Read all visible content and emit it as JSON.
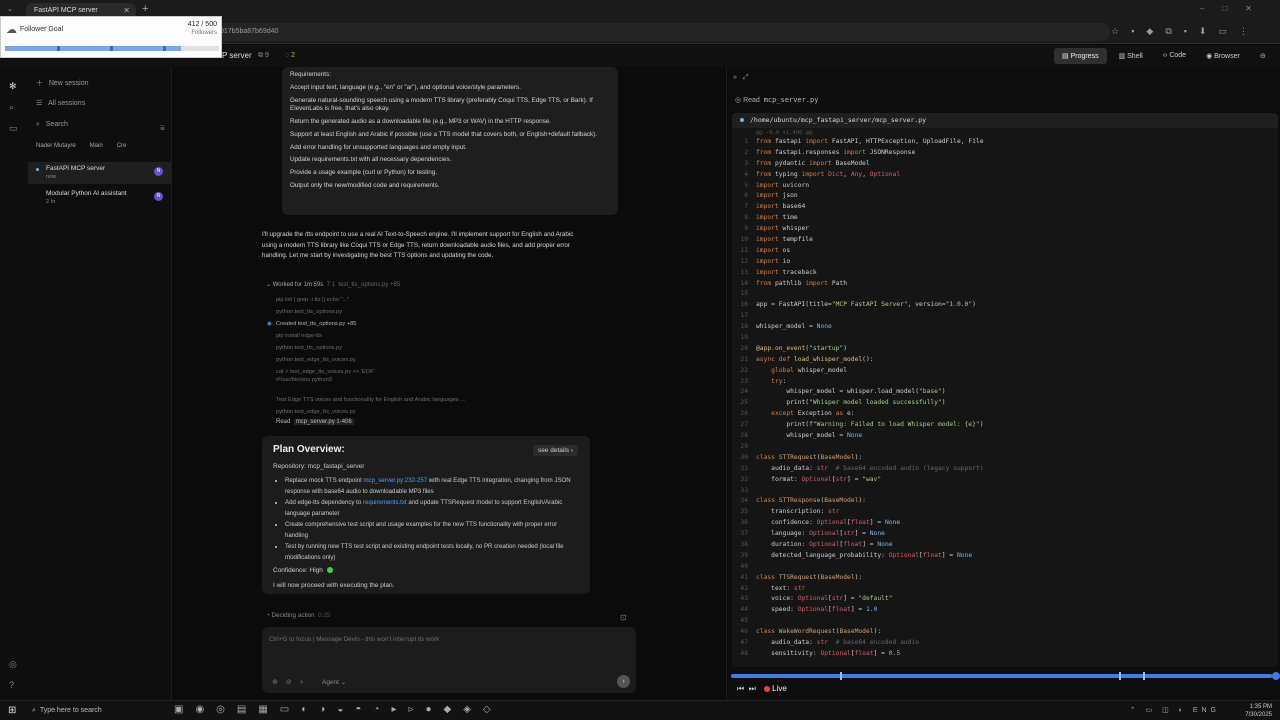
{
  "browser": {
    "tab_title": "FastAPI MCP server",
    "url_fragment": "917b5ba87b69d40"
  },
  "follower_goal": {
    "title": "Follower Goal",
    "count": "412 / 500",
    "label": "Followers",
    "progress": 0.824
  },
  "header": {
    "repo": "P server",
    "meta_count": "9",
    "meta_badge": "2",
    "tabs": [
      "Progress",
      "Shell",
      "Code",
      "Browser"
    ]
  },
  "sidebar": {
    "new_session": "New session",
    "all_sessions": "All sessions",
    "search": "Search",
    "user_tabs": [
      "Nader Mutayre",
      "Main",
      "Cre"
    ],
    "sessions": [
      {
        "title": "FastAPI MCP server",
        "sub": "now",
        "avatar": "N"
      },
      {
        "title": "Modular Python AI assistant",
        "sub": "2 hr",
        "avatar": "N"
      }
    ]
  },
  "chat": {
    "requirements_title": "Requirements:",
    "requirements": [
      "Accept input text, language (e.g., \"en\" or \"ar\"), and optional voice/style parameters.",
      "Generate natural-sounding speech using a modern TTS library (preferably Coqui TTS, Edge TTS, or Bark). If ElevenLabs is free, that's also okay.",
      "Return the generated audio as a downloadable file (e.g., MP3 or WAV) in the HTTP response.",
      "Support at least English and Arabic if possible (use a TTS model that covers both, or English+default fallback).",
      "Add error handling for unsupported languages and empty input.",
      "Update requirements.txt with all necessary dependencies.",
      "Provide a usage example (curl or Python) for testing.",
      "Output only the new/modified code and requirements."
    ],
    "reply": "I'll upgrade the /tts endpoint to use a real AI Text-to-Speech engine. I'll implement support for English and Arabic using a modern TTS library like Coqui TTS or Edge TTS, return downloadable audio files, and add proper error handling. Let me start by investigating the best TTS options and updating the code.",
    "worked": "Worked for 1m 59s",
    "worked_meta": "7   1",
    "worked_file": "test_tts_options.py +85",
    "steps": [
      "pip list | grep -i tts || echo \"...\"",
      "python test_tts_options.py",
      "Created test_tts_options.py +85",
      "pip install edge-tts",
      "python test_tts_options.py",
      "python test_edge_tts_voices.py",
      "cat > test_edge_tts_voices.py << 'EOF'",
      "#!/usr/bin/env python3",
      "Test Edge TTS voices and functionality for English and Arabic languages ...",
      "python test_edge_tts_voices.py"
    ],
    "read_label": "Read",
    "read_file": "mcp_server.py 1-406",
    "plan": {
      "title": "Plan Overview:",
      "see_details": "see details",
      "repository": "Repository: mcp_fastapi_server",
      "items": [
        {
          "pre": "Replace mock TTS endpoint ",
          "code": "mcp_server.py:232-257",
          "post": " with real Edge TTS integration, changing from JSON response with base64 audio to downloadable MP3 files"
        },
        {
          "pre": "Add edge-tts dependency to ",
          "code": "requirements.txt",
          "post": " and update TTSRequest model to support English/Arabic language parameter"
        },
        {
          "pre": "Create comprehensive test script and usage examples for the new TTS functionality with proper error handling",
          "code": "",
          "post": ""
        },
        {
          "pre": "Test by running new TTS test script and existing endpoint tests locally, no PR creation needed (local file modifications only)",
          "code": "",
          "post": ""
        }
      ],
      "confidence": "Confidence: High",
      "proceed": "I will now proceed with executing the plan."
    },
    "deciding": "Deciding action",
    "deciding_time": "0:25",
    "input_placeholder": "Ctrl+G to focus | Message Devin - this won't interrupt its work",
    "agent_label": "Agent"
  },
  "right_panel": {
    "read_label": "Read",
    "read_file": "mcp_server.py",
    "path": "/home/ubuntu/mcp_fastapi_server/mcp_server.py",
    "hunk": "@@ -0,0 +1,406 @@",
    "live_label": "Live",
    "timeline_progress": 0.99,
    "timeline_ticks": [
      0.2,
      0.71,
      0.755
    ]
  },
  "code_lines": [
    {
      "n": "1",
      "h": "<span class='kw'>from</span> fastapi <span class='kw'>import</span> FastAPI, HTTPException, UploadFile, File"
    },
    {
      "n": "2",
      "h": "<span class='kw'>from</span> fastapi.responses <span class='kw'>import</span> JSONResponse"
    },
    {
      "n": "3",
      "h": "<span class='kw'>from</span> pydantic <span class='kw'>import</span> BaseModel"
    },
    {
      "n": "4",
      "h": "<span class='kw'>from</span> typing <span class='kw'>import</span> <span class='ty'>Dict</span>, <span class='ty'>Any</span>, <span class='ty'>Optional</span>"
    },
    {
      "n": "5",
      "h": "<span class='kw'>import</span> uvicorn"
    },
    {
      "n": "6",
      "h": "<span class='kw'>import</span> json"
    },
    {
      "n": "7",
      "h": "<span class='kw'>import</span> base64"
    },
    {
      "n": "8",
      "h": "<span class='kw'>import</span> time"
    },
    {
      "n": "9",
      "h": "<span class='kw'>import</span> whisper"
    },
    {
      "n": "10",
      "h": "<span class='kw'>import</span> tempfile"
    },
    {
      "n": "11",
      "h": "<span class='kw'>import</span> os"
    },
    {
      "n": "12",
      "h": "<span class='kw'>import</span> io"
    },
    {
      "n": "13",
      "h": "<span class='kw'>import</span> traceback"
    },
    {
      "n": "14",
      "h": "<span class='kw'>from</span> pathlib <span class='kw'>import</span> Path"
    },
    {
      "n": "15",
      "h": ""
    },
    {
      "n": "16",
      "h": "app = FastAPI(title=<span class='st'>\"MCP FastAPI Server\"</span>, version=<span class='st'>\"1.0.0\"</span>)"
    },
    {
      "n": "17",
      "h": ""
    },
    {
      "n": "18",
      "h": "whisper_model = <span class='num'>None</span>"
    },
    {
      "n": "19",
      "h": ""
    },
    {
      "n": "20",
      "h": "<span class='fn-c'>@app.on_event</span>(<span class='st'>\"startup\"</span>)"
    },
    {
      "n": "21",
      "h": "<span class='kw'>async def</span> <span class='fn-c'>load_whisper_model</span>():"
    },
    {
      "n": "22",
      "h": "    <span class='kw'>global</span> whisper_model"
    },
    {
      "n": "23",
      "h": "    <span class='kw'>try</span>:"
    },
    {
      "n": "24",
      "h": "        whisper_model = whisper.load_model(<span class='st'>\"base\"</span>)"
    },
    {
      "n": "25",
      "h": "        print(<span class='st'>\"Whisper model loaded successfully\"</span>)"
    },
    {
      "n": "26",
      "h": "    <span class='kw'>except</span> Exception <span class='kw'>as</span> e:"
    },
    {
      "n": "27",
      "h": "        print(<span class='st'>f\"Warning: Failed to load Whisper model: {e}\"</span>)"
    },
    {
      "n": "28",
      "h": "        whisper_model = <span class='num'>None</span>"
    },
    {
      "n": "29",
      "h": ""
    },
    {
      "n": "30",
      "h": "<span class='kw'>class</span> <span class='cls'>STTRequest</span>(<span class='cls'>BaseModel</span>):"
    },
    {
      "n": "31",
      "h": "    audio_data: <span class='ty'>str</span>  <span class='cm'># base64 encoded audio (legacy support)</span>"
    },
    {
      "n": "32",
      "h": "    format: <span class='ty'>Optional</span>[<span class='ty'>str</span>] = <span class='st'>\"wav\"</span>"
    },
    {
      "n": "33",
      "h": ""
    },
    {
      "n": "34",
      "h": "<span class='kw'>class</span> <span class='cls'>STTResponse</span>(<span class='cls'>BaseModel</span>):"
    },
    {
      "n": "35",
      "h": "    transcription: <span class='ty'>str</span>"
    },
    {
      "n": "36",
      "h": "    confidence: <span class='ty'>Optional</span>[<span class='ty'>float</span>] = <span class='num'>None</span>"
    },
    {
      "n": "37",
      "h": "    language: <span class='ty'>Optional</span>[<span class='ty'>str</span>] = <span class='num'>None</span>"
    },
    {
      "n": "38",
      "h": "    duration: <span class='ty'>Optional</span>[<span class='ty'>float</span>] = <span class='num'>None</span>"
    },
    {
      "n": "39",
      "h": "    detected_language_probability: <span class='ty'>Optional</span>[<span class='ty'>float</span>] = <span class='num'>None</span>"
    },
    {
      "n": "40",
      "h": ""
    },
    {
      "n": "41",
      "h": "<span class='kw'>class</span> <span class='cls'>TTSRequest</span>(<span class='cls'>BaseModel</span>):"
    },
    {
      "n": "42",
      "h": "    text: <span class='ty'>str</span>"
    },
    {
      "n": "43",
      "h": "    voice: <span class='ty'>Optional</span>[<span class='ty'>str</span>] = <span class='st'>\"default\"</span>"
    },
    {
      "n": "44",
      "h": "    speed: <span class='ty'>Optional</span>[<span class='ty'>float</span>] = <span class='num'>1.0</span>"
    },
    {
      "n": "45",
      "h": ""
    },
    {
      "n": "46",
      "h": "<span class='kw'>class</span> <span class='cls'>WakeWordRequest</span>(<span class='cls'>BaseModel</span>):"
    },
    {
      "n": "47",
      "h": "    audio_data: <span class='ty'>str</span>  <span class='cm'># base64 encoded audio</span>"
    },
    {
      "n": "48",
      "h": "    sensitivity: <span class='ty'>Optional</span>[<span class='ty'>float</span>] = <span class='num'>0.5</span>"
    }
  ],
  "taskbar": {
    "search_placeholder": "Type here to search",
    "lang": "ENG",
    "time": "1:35 PM",
    "date": "7/30/2025"
  }
}
